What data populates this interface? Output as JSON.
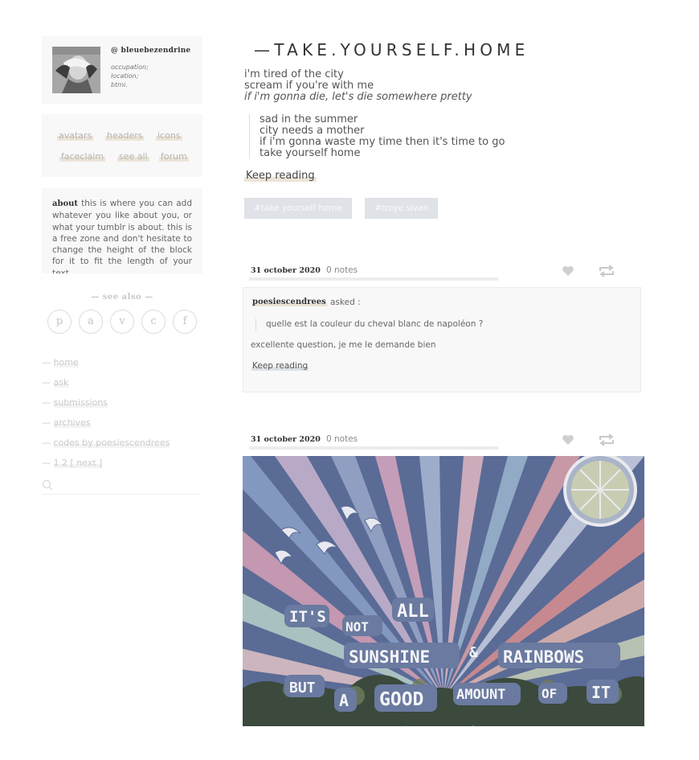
{
  "profile": {
    "username": "@ bleuebezendrine",
    "occupation": "occupation;",
    "location": "location;",
    "btmi": "btmi."
  },
  "nav": {
    "avatars": "avatars",
    "headers": "headers",
    "icons": "icons",
    "faceclaim": "faceclaim",
    "see_all": "see all",
    "forum": "forum"
  },
  "about": {
    "label": "about",
    "text": "this is where you can add whatever you like about you, or what your tumblr is about. this is a free zone and don't hesitate to change the height of the block for it to fit the length of your text."
  },
  "see_also": {
    "title": "— see also —",
    "letters": [
      "p",
      "a",
      "v",
      "c",
      "f"
    ]
  },
  "menu": {
    "dash": "—",
    "home": "home",
    "ask": "ask",
    "submissions": "submissions",
    "archives": "archives",
    "codes": "codes by poesiescendrees",
    "pages": "1  2   [ next ]"
  },
  "post1": {
    "title": "—TAKE.YOURSELF.HOME",
    "lines": [
      "i'm tired of the city",
      "scream if you're with me"
    ],
    "italic_line": "if i'm gonna die, let's die somewhere pretty",
    "quote": [
      "sad in the summer",
      "city needs a mother",
      "if i'm gonna waste my time then it's time to go",
      "take yourself home"
    ],
    "keep_reading": "Keep reading",
    "tags": [
      "#take yourself home",
      "#troye sivan"
    ]
  },
  "post2": {
    "date": "31 october 2020",
    "notes": "0 notes",
    "asker": "poesiescendrees",
    "asked": "asked :",
    "question": "quelle est la couleur du cheval blanc de napoléon ?",
    "answer": "excellente question, je me le demande bien",
    "keep_reading": "Keep reading"
  },
  "post3": {
    "date": "31 october 2020",
    "notes": "0 notes",
    "image_words": [
      "IT'S",
      "NOT",
      "ALL",
      "SUNSHINE",
      "&",
      "RAINBOWS",
      "BUT",
      "A",
      "GOOD",
      "AMOUNT",
      "OF",
      "IT"
    ]
  },
  "icons": {
    "heart": "heart-icon",
    "reblog": "reblog-icon",
    "search": "search-icon"
  }
}
